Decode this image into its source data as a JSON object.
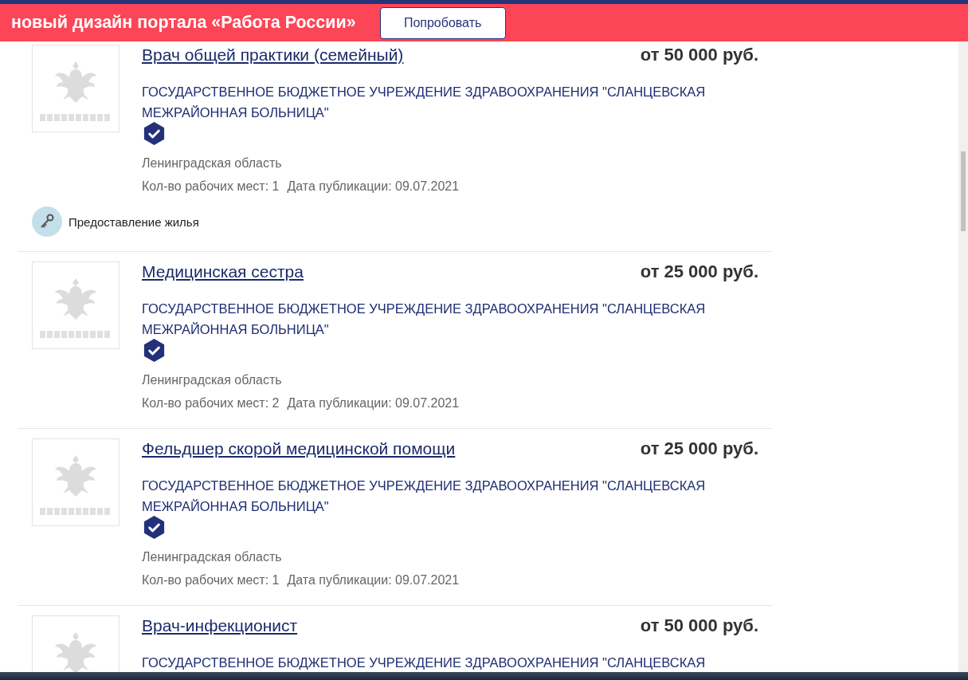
{
  "banner": {
    "text": "новый дизайн портала «Работа России»",
    "button": "Попробовать"
  },
  "vacancies": [
    {
      "title": "Врач общей практики (семейный)",
      "salary": "от 50 000 руб.",
      "org": "ГОСУДАРСТВЕННОЕ БЮДЖЕТНОЕ УЧРЕЖДЕНИЕ ЗДРАВООХРАНЕНИЯ \"СЛАНЦЕВСКАЯ МЕЖРАЙОННАЯ БОЛЬНИЦА\"",
      "verified": true,
      "region": "Ленинградская область",
      "places": "Кол-во рабочих мест: 1",
      "date": "Дата публикации: 09.07.2021",
      "features": [
        {
          "label": "Предоставление жилья"
        }
      ]
    },
    {
      "title": "Медицинская сестра",
      "salary": "от 25 000 руб.",
      "org": "ГОСУДАРСТВЕННОЕ БЮДЖЕТНОЕ УЧРЕЖДЕНИЕ ЗДРАВООХРАНЕНИЯ \"СЛАНЦЕВСКАЯ МЕЖРАЙОННАЯ БОЛЬНИЦА\"",
      "verified": true,
      "region": "Ленинградская область",
      "places": "Кол-во рабочих мест: 2",
      "date": "Дата публикации: 09.07.2021"
    },
    {
      "title": "Фельдшер скорой медицинской помощи",
      "salary": "от 25 000 руб.",
      "org": "ГОСУДАРСТВЕННОЕ БЮДЖЕТНОЕ УЧРЕЖДЕНИЕ ЗДРАВООХРАНЕНИЯ \"СЛАНЦЕВСКАЯ МЕЖРАЙОННАЯ БОЛЬНИЦА\"",
      "verified": true,
      "region": "Ленинградская область",
      "places": "Кол-во рабочих мест: 1",
      "date": "Дата публикации: 09.07.2021"
    },
    {
      "title": "Врач-инфекционист",
      "salary": "от 50 000 руб.",
      "org": "ГОСУДАРСТВЕННОЕ БЮДЖЕТНОЕ УЧРЕЖДЕНИЕ ЗДРАВООХРАНЕНИЯ \"СЛАНЦЕВСКАЯ"
    }
  ]
}
